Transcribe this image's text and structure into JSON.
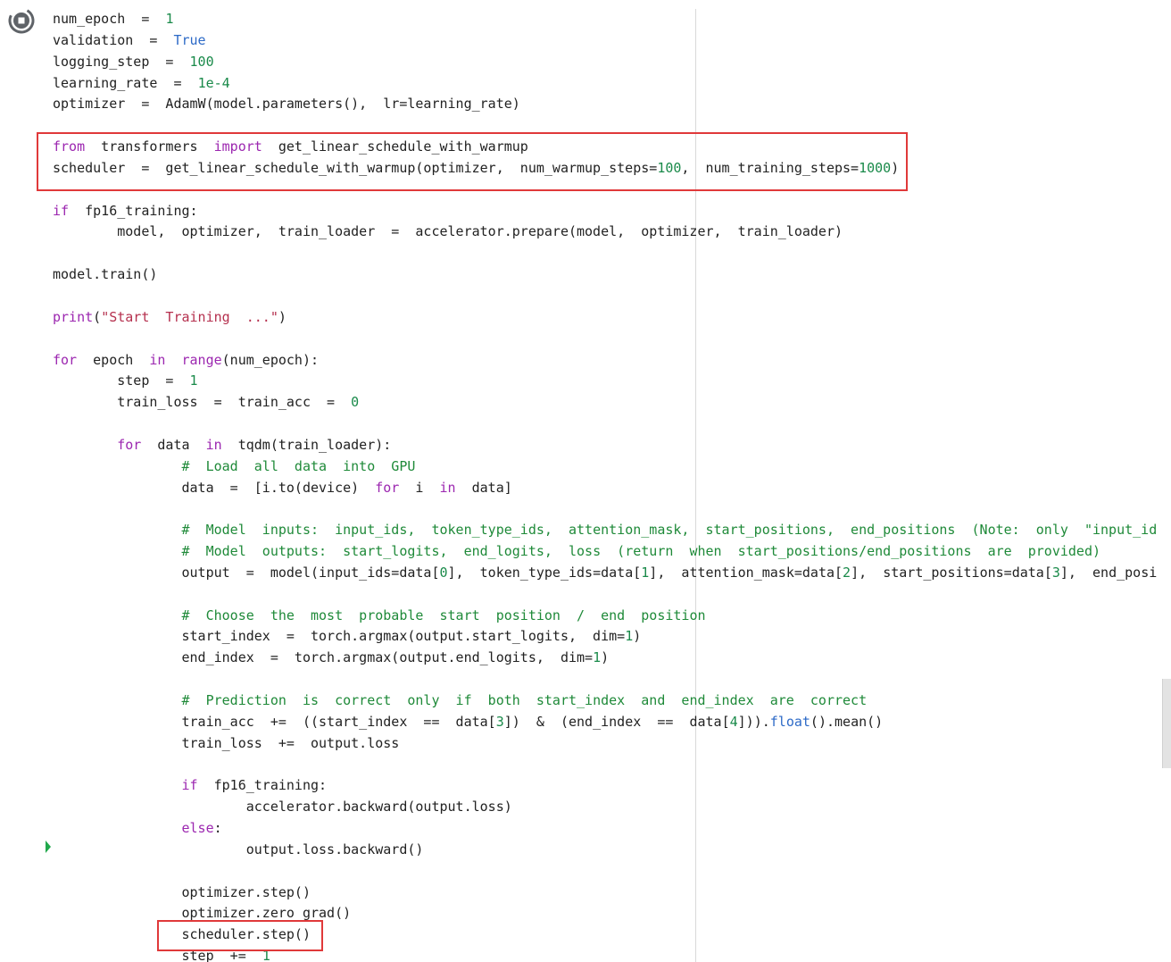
{
  "cell": {
    "run_icon": "stop-icon",
    "lines": [
      [
        [
          "num_epoch  =  ",
          "p"
        ],
        [
          "1",
          "num"
        ]
      ],
      [
        [
          "validation  =  ",
          "p"
        ],
        [
          "True",
          "nb"
        ]
      ],
      [
        [
          "logging_step  =  ",
          "p"
        ],
        [
          "100",
          "num"
        ]
      ],
      [
        [
          "learning_rate  =  ",
          "p"
        ],
        [
          "1e-4",
          "num"
        ]
      ],
      [
        [
          "optimizer  =  AdamW(model.parameters(),  lr=learning_rate)",
          "p"
        ]
      ],
      [],
      [
        [
          "from",
          "kw"
        ],
        [
          "  transformers  ",
          "p"
        ],
        [
          "import",
          "kw"
        ],
        [
          "  get_linear_schedule_with_warmup",
          "p"
        ]
      ],
      [
        [
          "scheduler  =  get_linear_schedule_with_warmup(optimizer,  num_warmup_steps=",
          "p"
        ],
        [
          "100",
          "num"
        ],
        [
          ",  num_training_steps=",
          "p"
        ],
        [
          "1000",
          "num"
        ],
        [
          ")",
          "p"
        ]
      ],
      [],
      [
        [
          "if",
          "kw"
        ],
        [
          "  fp16_training:",
          "p"
        ]
      ],
      [
        [
          "        model,  optimizer,  train_loader  =  accelerator.prepare(model,  optimizer,  train_loader)",
          "p"
        ]
      ],
      [],
      [
        [
          "model.train()",
          "p"
        ]
      ],
      [],
      [
        [
          "print",
          "kw"
        ],
        [
          "(",
          "p"
        ],
        [
          "\"Start  Training  ...\"",
          "str"
        ],
        [
          ")",
          "p"
        ]
      ],
      [],
      [
        [
          "for",
          "kw"
        ],
        [
          "  epoch  ",
          "p"
        ],
        [
          "in",
          "kw"
        ],
        [
          "  ",
          "p"
        ],
        [
          "range",
          "kw"
        ],
        [
          "(num_epoch):",
          "p"
        ]
      ],
      [
        [
          "        step  =  ",
          "p"
        ],
        [
          "1",
          "num"
        ]
      ],
      [
        [
          "        train_loss  =  train_acc  =  ",
          "p"
        ],
        [
          "0",
          "num"
        ]
      ],
      [],
      [
        [
          "        ",
          "p"
        ],
        [
          "for",
          "kw"
        ],
        [
          "  data  ",
          "p"
        ],
        [
          "in",
          "kw"
        ],
        [
          "  tqdm(train_loader):",
          "p"
        ]
      ],
      [
        [
          "                ",
          "p"
        ],
        [
          "#  Load  all  data  into  GPU",
          "cm"
        ]
      ],
      [
        [
          "                data  =  [i.to(device)  ",
          "p"
        ],
        [
          "for",
          "kw"
        ],
        [
          "  i  ",
          "p"
        ],
        [
          "in",
          "kw"
        ],
        [
          "  data]",
          "p"
        ]
      ],
      [],
      [
        [
          "                ",
          "p"
        ],
        [
          "#  Model  inputs:  input_ids,  token_type_ids,  attention_mask,  start_positions,  end_positions  (Note:  only  \"input_id",
          "cm"
        ]
      ],
      [
        [
          "                ",
          "p"
        ],
        [
          "#  Model  outputs:  start_logits,  end_logits,  loss  (return  when  start_positions/end_positions  are  provided)",
          "cm"
        ]
      ],
      [
        [
          "                output  =  model(input_ids=data[",
          "p"
        ],
        [
          "0",
          "num"
        ],
        [
          "],  token_type_ids=data[",
          "p"
        ],
        [
          "1",
          "num"
        ],
        [
          "],  attention_mask=data[",
          "p"
        ],
        [
          "2",
          "num"
        ],
        [
          "],  start_positions=data[",
          "p"
        ],
        [
          "3",
          "num"
        ],
        [
          "],  end_posi",
          "p"
        ]
      ],
      [],
      [
        [
          "                ",
          "p"
        ],
        [
          "#  Choose  the  most  probable  start  position  /  end  position",
          "cm"
        ]
      ],
      [
        [
          "                start_index  =  torch.argmax(output.start_logits,  dim=",
          "p"
        ],
        [
          "1",
          "num"
        ],
        [
          ")",
          "p"
        ]
      ],
      [
        [
          "                end_index  =  torch.argmax(output.end_logits,  dim=",
          "p"
        ],
        [
          "1",
          "num"
        ],
        [
          ")",
          "p"
        ]
      ],
      [],
      [
        [
          "                ",
          "p"
        ],
        [
          "#  Prediction  is  correct  only  if  both  start_index  and  end_index  are  correct",
          "cm"
        ]
      ],
      [
        [
          "                train_acc  +=  ((start_index  ==  data[",
          "p"
        ],
        [
          "3",
          "num"
        ],
        [
          "])  &  (end_index  ==  data[",
          "p"
        ],
        [
          "4",
          "num"
        ],
        [
          "])).",
          "p"
        ],
        [
          "float",
          "nb"
        ],
        [
          "().mean()",
          "p"
        ]
      ],
      [
        [
          "                train_loss  +=  output.loss",
          "p"
        ]
      ],
      [],
      [
        [
          "                ",
          "p"
        ],
        [
          "if",
          "kw"
        ],
        [
          "  fp16_training:",
          "p"
        ]
      ],
      [
        [
          "                        accelerator.backward(output.loss)",
          "p"
        ]
      ],
      [
        [
          "                ",
          "p"
        ],
        [
          "else",
          "kw"
        ],
        [
          ":",
          "p"
        ]
      ],
      [
        [
          "                        output.loss.backward()",
          "p"
        ]
      ],
      [],
      [
        [
          "                optimizer.step()",
          "p"
        ]
      ],
      [
        [
          "                optimizer.zero_grad()",
          "p"
        ]
      ],
      [
        [
          "                scheduler.step()",
          "p"
        ]
      ],
      [
        [
          "                step  +=  ",
          "p"
        ],
        [
          "1",
          "num"
        ]
      ]
    ]
  },
  "colors": {
    "keyword": "#9c27b0",
    "builtin": "#2d6ac7",
    "number": "#1a8a4a",
    "string": "#b5304e",
    "comment": "#1f8a39",
    "highlight_box": "#e0393a"
  }
}
